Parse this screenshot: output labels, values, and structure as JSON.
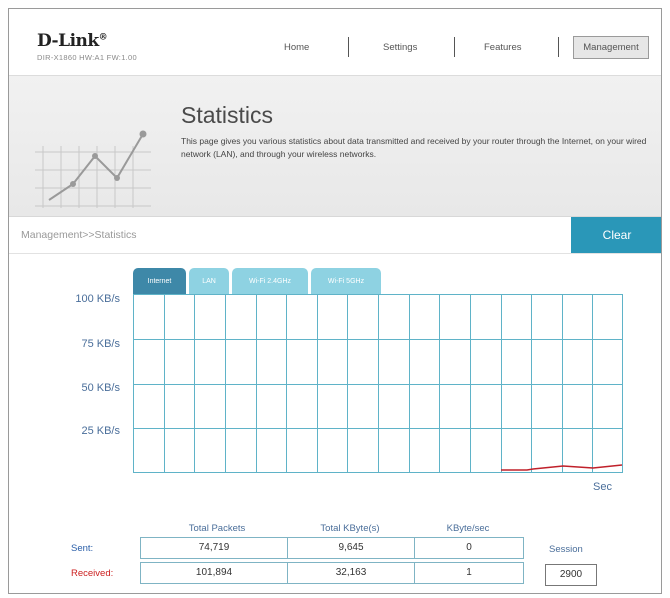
{
  "header": {
    "brand": "D-Link",
    "brand_mark": "®",
    "model": "DIR-X1860 HW:A1 FW:1.00",
    "nav": [
      {
        "label": "Home"
      },
      {
        "label": "Settings"
      },
      {
        "label": "Features"
      },
      {
        "label": "Management"
      }
    ]
  },
  "banner": {
    "title": "Statistics",
    "description": "This page gives you various statistics about data transmitted and received by your router through the Internet, on your wired network (LAN), and through your wireless networks."
  },
  "breadcrumb": "Management>>Statistics",
  "clear_label": "Clear",
  "tabs": [
    {
      "label": "Internet",
      "active": true
    },
    {
      "label": "LAN",
      "active": false
    },
    {
      "label": "Wi-Fi 2.4GHz",
      "active": false
    },
    {
      "label": "Wi-Fi 5GHz",
      "active": false
    }
  ],
  "chart": {
    "y_labels": [
      "100 KB/s",
      "75 KB/s",
      "50 KB/s",
      "25 KB/s"
    ],
    "x_unit": "Sec",
    "line_color": "#c0202a",
    "grid_color": "#5fb3c8"
  },
  "stats": {
    "columns": [
      "Total Packets",
      "Total KByte(s)",
      "KByte/sec"
    ],
    "rows": [
      {
        "label": "Sent:",
        "color": "#2a5ea8",
        "values": [
          "74,719",
          "9,645",
          "0"
        ]
      },
      {
        "label": "Received:",
        "color": "#cc1f1f",
        "values": [
          "101,894",
          "32,163",
          "1"
        ]
      }
    ],
    "session_label": "Session",
    "session_value": "2900"
  }
}
